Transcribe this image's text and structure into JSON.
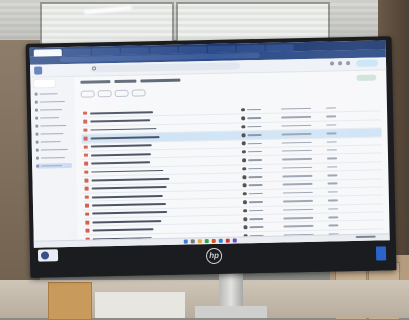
{
  "scene": {
    "description_colors": {
      "wall": "#8d7d6a",
      "monitor_bezel": "#1b1c1f",
      "screen_bg": "#f7f8fa",
      "selected_row": "#cfe4f6",
      "accent": "#1f3a73"
    }
  },
  "monitor": {
    "brand_logo": "hp",
    "screen": {
      "browser": {
        "tab_count": 9,
        "active_tab_index": 0
      },
      "app": {
        "sidebar_items": 10,
        "active_sidebar_index": 9,
        "list": {
          "row_count": 19,
          "selected_row_index": 3,
          "name_lengths": [
            0.42,
            0.4,
            0.44,
            0.46,
            0.41,
            0.4,
            0.39,
            0.48,
            0.52,
            0.5,
            0.47,
            0.49,
            0.5,
            0.46,
            0.41,
            0.39,
            0.36,
            0.33,
            0.35
          ]
        }
      }
    }
  }
}
